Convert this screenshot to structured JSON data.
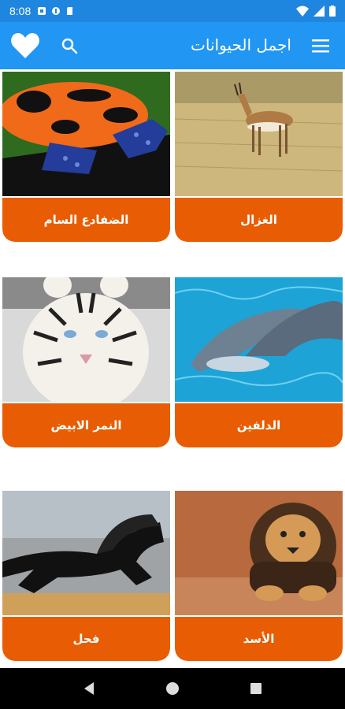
{
  "status_bar": {
    "time": "8:08"
  },
  "app_bar": {
    "title": "اجمل الحيوانات"
  },
  "animals": [
    {
      "label": "الغزال"
    },
    {
      "label": "الضفادع السام"
    },
    {
      "label": "الدلفين"
    },
    {
      "label": "النمر الابيض"
    },
    {
      "label": "الأسد"
    },
    {
      "label": "فحل"
    }
  ],
  "colors": {
    "status_bar": "#1f86e0",
    "app_bar": "#2196f3",
    "card_label": "#e85d04"
  },
  "icons": [
    "menu-icon",
    "search-icon",
    "heart-icon",
    "back-icon",
    "home-icon",
    "recents-icon"
  ]
}
